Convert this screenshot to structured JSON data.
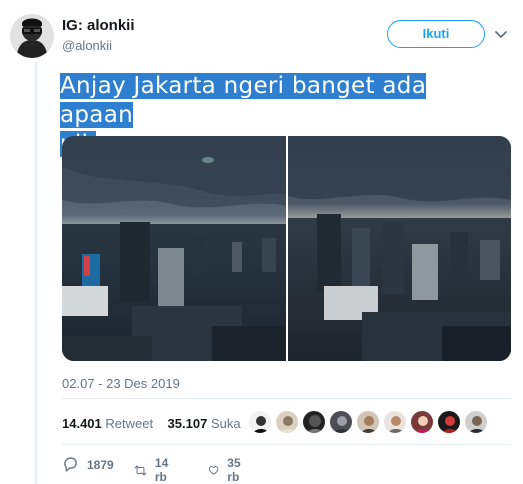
{
  "author": {
    "display_name": "IG: alonkii",
    "handle": "@alonkii"
  },
  "follow_button_label": "Ikuti",
  "tweet_text_lines": [
    "Anjay Jakarta ngeri banget ada apaan",
    "nih"
  ],
  "timestamp": "02.07 - 23 Des 2019",
  "stats": {
    "retweets_count": "14.401",
    "retweets_label": "Retweet",
    "likes_count": "35.107",
    "likes_label": "Suka"
  },
  "actions": {
    "reply_count": "1879",
    "retweet_count": "14 rb",
    "like_count": "35 rb"
  },
  "colors": {
    "accent": "#1da1f2",
    "selection": "#2f7fd1",
    "secondary_text": "#657786",
    "divider": "#e6ecf0"
  },
  "icons": [
    "chevron-down-icon",
    "reply-icon",
    "retweet-icon",
    "heart-icon"
  ]
}
